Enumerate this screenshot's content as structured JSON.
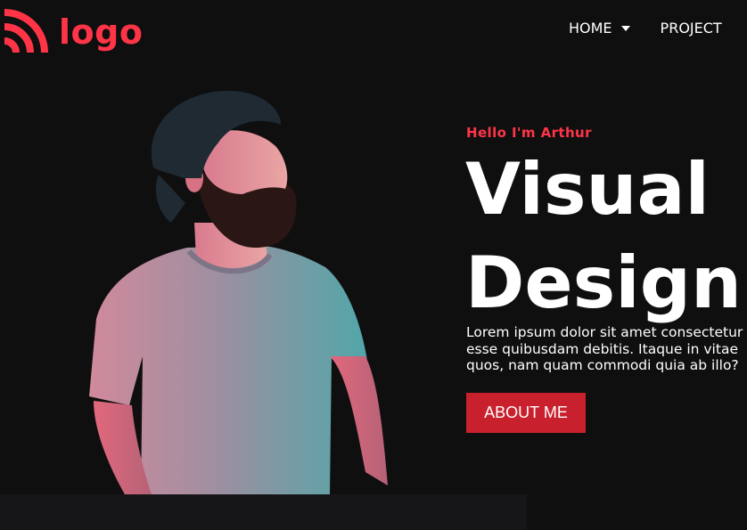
{
  "header": {
    "logo_text": "logo",
    "nav": [
      {
        "label": "HOME",
        "has_dropdown": true
      },
      {
        "label": "PROJECT",
        "has_dropdown": false
      }
    ]
  },
  "hero": {
    "greeting": "Hello  I'm  Arthur",
    "title_line1": "Visual",
    "title_line2": "Design",
    "description_lines": [
      "Lorem ipsum dolor sit amet consectetur",
      "esse quibusdam debitis. Itaque in vitae",
      "quos, nam quam commodi quia ab illo?"
    ],
    "cta_label": "ABOUT ME"
  },
  "colors": {
    "background": "#0f0f10",
    "accent": "#ff3547",
    "button": "#c8202d",
    "text": "#ffffff"
  },
  "icons": [
    "wifi-logo-icon",
    "caret-down-icon"
  ]
}
